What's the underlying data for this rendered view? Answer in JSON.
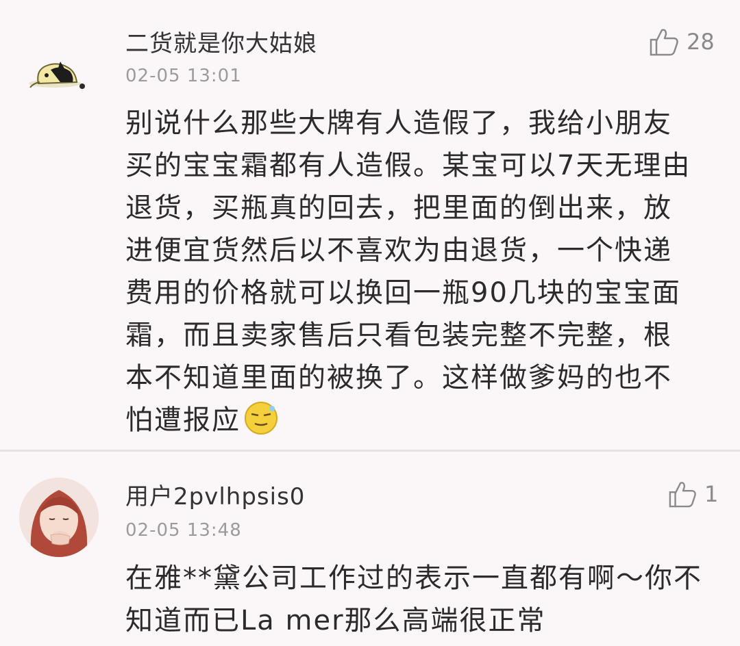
{
  "comments": [
    {
      "username": "二货就是你大姑娘",
      "time": "02-05 13:01",
      "likes": "28",
      "avatar": "cartoon-animal-avatar",
      "lines": [
        "别说什么那些大牌有人造假了，我给小朋友",
        "买的宝宝霜都有人造假。某宝可以7天无理由",
        "退货，买瓶真的回去，把里面的倒出来，放",
        "进便宜货然后以不喜欢为由退货，一个快递",
        "费用的价格就可以换回一瓶90几块的宝宝面",
        "霜，而且卖家售后只看包装完整不完整，根",
        "本不知道里面的被换了。这样做爹妈的也不",
        "怕遭报应"
      ],
      "emoji": "awkward-smile-emoji"
    },
    {
      "username": "用户2pvlhpsis0",
      "time": "02-05 13:48",
      "likes": "1",
      "avatar": "girl-photo-avatar",
      "lines": [
        "在雅**黛公司工作过的表示一直都有啊～你不",
        "知道而已La mer那么高端很正常"
      ]
    }
  ],
  "colors": {
    "background": "#fbf6f8",
    "text": "#2b2b2b",
    "meta": "#9b9b9b",
    "divider": "#e6e0e3"
  }
}
